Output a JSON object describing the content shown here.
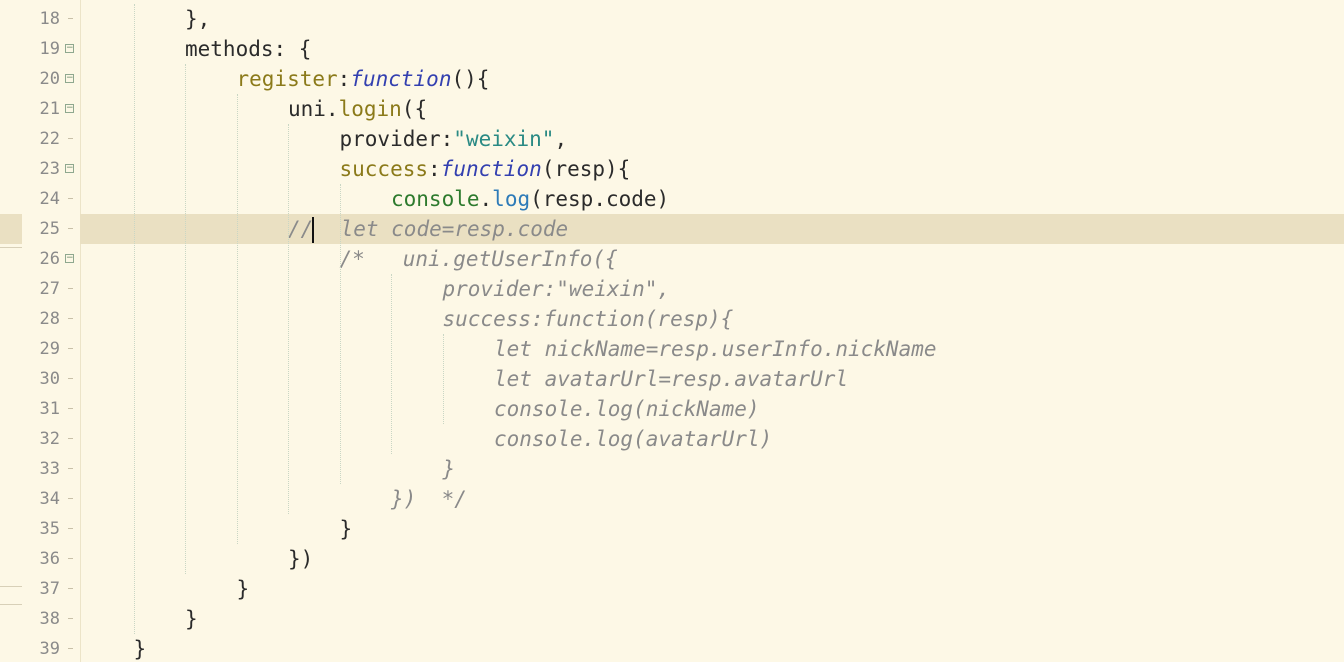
{
  "editor": {
    "current_line": 25,
    "lines": [
      {
        "n": "18",
        "fold": false,
        "indent": 2,
        "tokens": [
          {
            "t": "},",
            "c": "plain"
          }
        ]
      },
      {
        "n": "19",
        "fold": true,
        "indent": 2,
        "tokens": [
          {
            "t": "methods: {",
            "c": "plain"
          }
        ]
      },
      {
        "n": "20",
        "fold": true,
        "indent": 3,
        "tokens": [
          {
            "t": "register",
            "c": "key"
          },
          {
            "t": ":",
            "c": "plain"
          },
          {
            "t": "function",
            "c": "kw"
          },
          {
            "t": "(){",
            "c": "plain"
          }
        ]
      },
      {
        "n": "21",
        "fold": true,
        "indent": 4,
        "tokens": [
          {
            "t": "uni.",
            "c": "plain"
          },
          {
            "t": "login",
            "c": "call"
          },
          {
            "t": "({",
            "c": "plain"
          }
        ]
      },
      {
        "n": "22",
        "fold": false,
        "indent": 5,
        "tokens": [
          {
            "t": "provider:",
            "c": "plain"
          },
          {
            "t": "\"weixin\"",
            "c": "str"
          },
          {
            "t": ",",
            "c": "plain"
          }
        ]
      },
      {
        "n": "23",
        "fold": true,
        "indent": 5,
        "tokens": [
          {
            "t": "success",
            "c": "key"
          },
          {
            "t": ":",
            "c": "plain"
          },
          {
            "t": "function",
            "c": "kw"
          },
          {
            "t": "(resp){",
            "c": "plain"
          }
        ]
      },
      {
        "n": "24",
        "fold": false,
        "indent": 6,
        "tokens": [
          {
            "t": "console",
            "c": "green"
          },
          {
            "t": ".",
            "c": "plain"
          },
          {
            "t": "log",
            "c": "method"
          },
          {
            "t": "(resp.code)",
            "c": "plain"
          }
        ]
      },
      {
        "n": "25",
        "fold": false,
        "indent": 4,
        "tokens": [
          {
            "t": "//",
            "c": "comment"
          },
          {
            "t": "  let code=resp.code",
            "c": "comment"
          }
        ]
      },
      {
        "n": "26",
        "fold": true,
        "indent": 5,
        "tokens": [
          {
            "t": "/*   uni.getUserInfo({",
            "c": "comment"
          }
        ]
      },
      {
        "n": "27",
        "fold": false,
        "indent": 7,
        "tokens": [
          {
            "t": "provider:\"weixin\",",
            "c": "comment"
          }
        ]
      },
      {
        "n": "28",
        "fold": false,
        "indent": 7,
        "tokens": [
          {
            "t": "success:function(resp){",
            "c": "comment"
          }
        ]
      },
      {
        "n": "29",
        "fold": false,
        "indent": 8,
        "tokens": [
          {
            "t": "let nickName=resp.userInfo.nickName",
            "c": "comment"
          }
        ]
      },
      {
        "n": "30",
        "fold": false,
        "indent": 8,
        "tokens": [
          {
            "t": "let avatarUrl=resp.avatarUrl",
            "c": "comment"
          }
        ]
      },
      {
        "n": "31",
        "fold": false,
        "indent": 8,
        "tokens": [
          {
            "t": "console.log(nickName)",
            "c": "comment"
          }
        ]
      },
      {
        "n": "32",
        "fold": false,
        "indent": 8,
        "tokens": [
          {
            "t": "console.log(avatarUrl)",
            "c": "comment"
          }
        ]
      },
      {
        "n": "33",
        "fold": false,
        "indent": 7,
        "tokens": [
          {
            "t": "}",
            "c": "comment"
          }
        ]
      },
      {
        "n": "34",
        "fold": false,
        "indent": 6,
        "tokens": [
          {
            "t": "})  */",
            "c": "comment"
          }
        ]
      },
      {
        "n": "35",
        "fold": false,
        "indent": 5,
        "tokens": [
          {
            "t": "}",
            "c": "plain"
          }
        ]
      },
      {
        "n": "36",
        "fold": false,
        "indent": 4,
        "tokens": [
          {
            "t": "})",
            "c": "plain"
          }
        ]
      },
      {
        "n": "37",
        "fold": false,
        "indent": 3,
        "tokens": [
          {
            "t": "}",
            "c": "plain"
          }
        ]
      },
      {
        "n": "38",
        "fold": false,
        "indent": 2,
        "tokens": [
          {
            "t": "}",
            "c": "plain"
          }
        ]
      },
      {
        "n": "39",
        "fold": false,
        "indent": 1,
        "tokens": [
          {
            "t": "}",
            "c": "plain"
          }
        ]
      }
    ]
  }
}
